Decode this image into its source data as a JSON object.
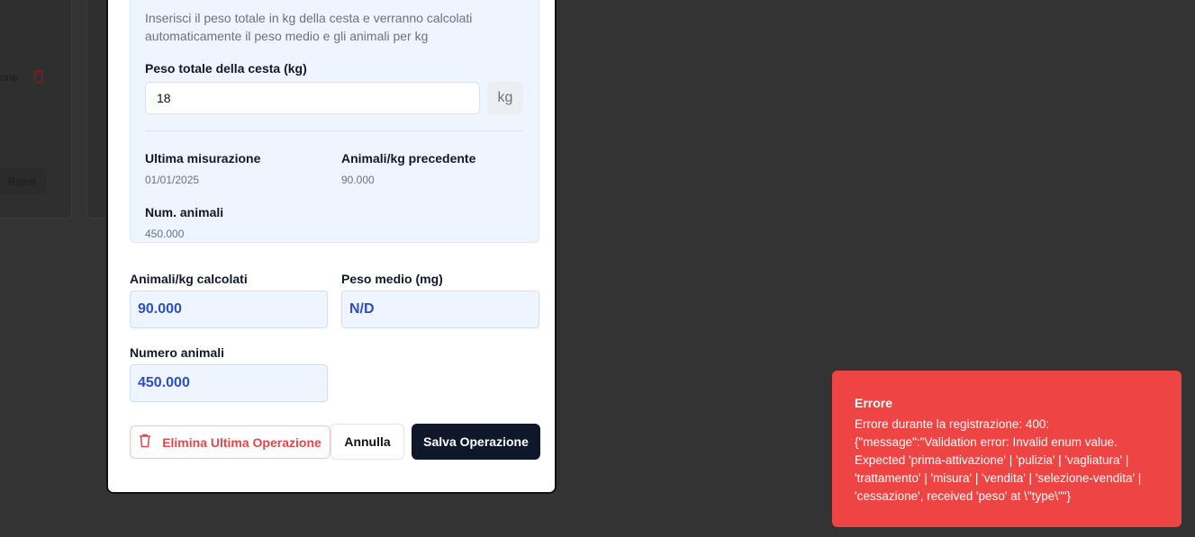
{
  "background": {
    "partial_text": "one",
    "repeat_button_label": "Ripeti"
  },
  "form": {
    "help_text": "Inserisci il peso totale in kg della cesta e verranno calcolati automaticamente il peso medio e gli animali per kg",
    "total_weight_label": "Peso totale della cesta (kg)",
    "total_weight_value": "18",
    "unit_label": "kg",
    "last_measurement_label": "Ultima misurazione",
    "last_measurement_value": "01/01/2025",
    "prev_animals_per_kg_label": "Animali/kg precedente",
    "prev_animals_per_kg_value": "90.000",
    "num_animals_label": "Num. animali",
    "num_animals_value": "450.000",
    "calc_animals_per_kg_label": "Animali/kg calcolati",
    "calc_animals_per_kg_value": "90.000",
    "avg_weight_label": "Peso medio (mg)",
    "avg_weight_value": "N/D",
    "total_animals_label": "Numero animali",
    "total_animals_value": "450.000"
  },
  "actions": {
    "delete_label": "Elimina Ultima Operazione",
    "cancel_label": "Annulla",
    "save_label": "Salva Operazione"
  },
  "toast": {
    "title": "Errore",
    "message": "Errore durante la registrazione: 400: {\"message\":\"Validation error: Invalid enum value. Expected 'prima-attivazione' | 'pulizia' | 'vagliatura' | 'trattamento' | 'misura' | 'vendita' | 'selezione-vendita' | 'cessazione', received 'peso' at \\\"type\\\"\"}"
  },
  "colors": {
    "toast_bg": "#ef4444",
    "primary": "#0f172a",
    "danger": "#e04848",
    "calc_text": "#2d4fbf"
  },
  "icons": {
    "delete": "trash-icon",
    "background_delete": "trash-icon"
  }
}
